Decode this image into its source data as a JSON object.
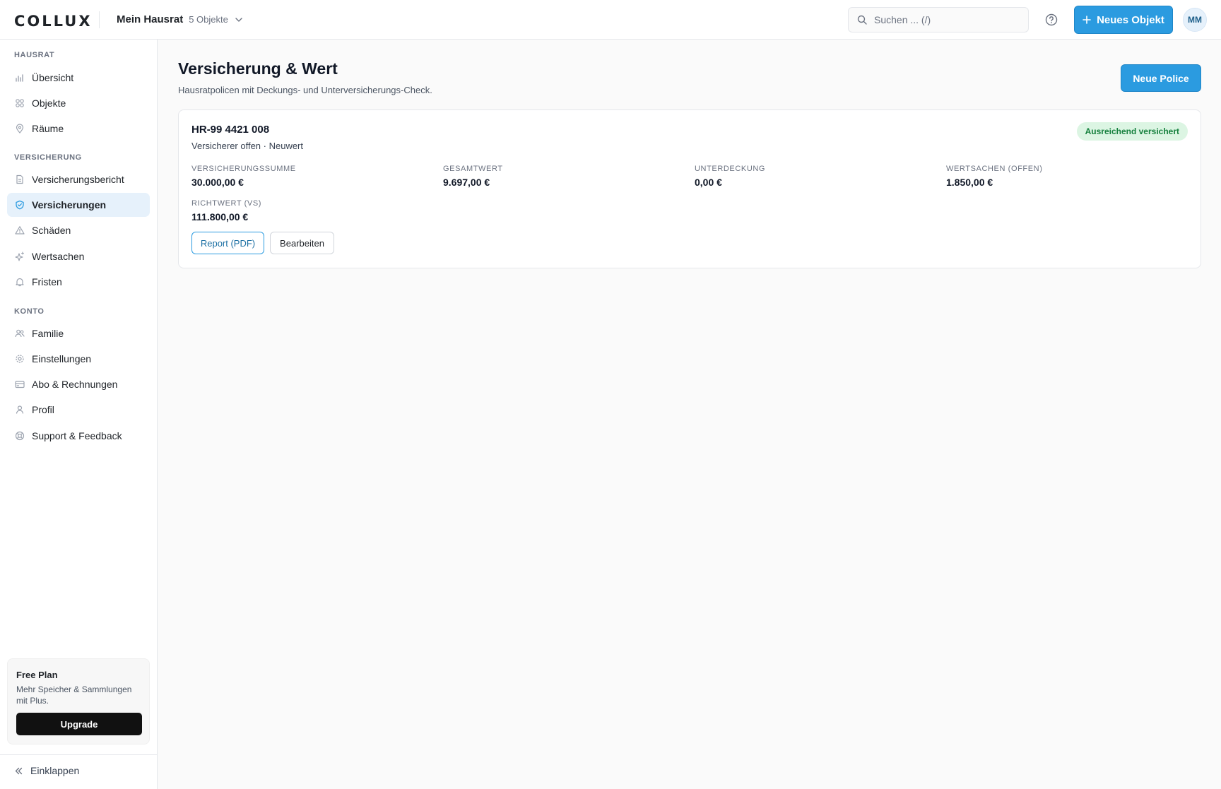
{
  "brand": {
    "logo": "COLLUX"
  },
  "workspace": {
    "name": "Mein Hausrat",
    "count": "5 Objekte"
  },
  "search": {
    "placeholder": "Suchen ... (/)"
  },
  "header": {
    "new_object_label": "Neues Objekt",
    "avatar_initials": "MM"
  },
  "sidebar": {
    "sections": [
      {
        "title": "HAUSRAT",
        "items": [
          {
            "label": "Übersicht",
            "icon": "bar-chart-icon"
          },
          {
            "label": "Objekte",
            "icon": "grid-icon"
          },
          {
            "label": "Räume",
            "icon": "map-pin-icon"
          }
        ]
      },
      {
        "title": "VERSICHERUNG",
        "items": [
          {
            "label": "Versicherungsbericht",
            "icon": "document-icon"
          },
          {
            "label": "Versicherungen",
            "icon": "shield-icon",
            "active": true
          },
          {
            "label": "Schäden",
            "icon": "warning-icon"
          },
          {
            "label": "Wertsachen",
            "icon": "sparkle-icon"
          },
          {
            "label": "Fristen",
            "icon": "bell-icon"
          }
        ]
      },
      {
        "title": "KONTO",
        "items": [
          {
            "label": "Familie",
            "icon": "users-icon"
          },
          {
            "label": "Einstellungen",
            "icon": "settings-icon"
          },
          {
            "label": "Abo & Rechnungen",
            "icon": "credit-card-icon"
          },
          {
            "label": "Profil",
            "icon": "user-icon"
          },
          {
            "label": "Support & Feedback",
            "icon": "lifebuoy-icon"
          }
        ]
      }
    ],
    "plan": {
      "title": "Free Plan",
      "description": "Mehr Speicher & Sammlungen mit Plus.",
      "button": "Upgrade"
    },
    "collapse_label": "Einklappen"
  },
  "main": {
    "title": "Versicherung & Wert",
    "subtitle": "Hausratpolicen mit Deckungs- und Unterversicherungs-Check.",
    "new_policy_label": "Neue Police",
    "policy": {
      "number": "HR-99 4421 008",
      "meta": "Versicherer offen · Neuwert",
      "status": "Ausreichend versichert",
      "stats": [
        {
          "label": "VERSICHERUNGSSUMME",
          "value": "30.000,00 €"
        },
        {
          "label": "GESAMTWERT",
          "value": "9.697,00 €"
        },
        {
          "label": "UNTERDECKUNG",
          "value": "0,00 €"
        },
        {
          "label": "WERTSACHEN (OFFEN)",
          "value": "1.850,00 €"
        },
        {
          "label": "RICHTWERT (VS)",
          "value": "111.800,00 €"
        }
      ],
      "report_label": "Report (PDF)",
      "edit_label": "Bearbeiten"
    }
  },
  "colors": {
    "accent": "#2b9be0",
    "active_bg": "#e6f1fb",
    "success_bg": "#dcf5e3",
    "success_text": "#15803d"
  }
}
